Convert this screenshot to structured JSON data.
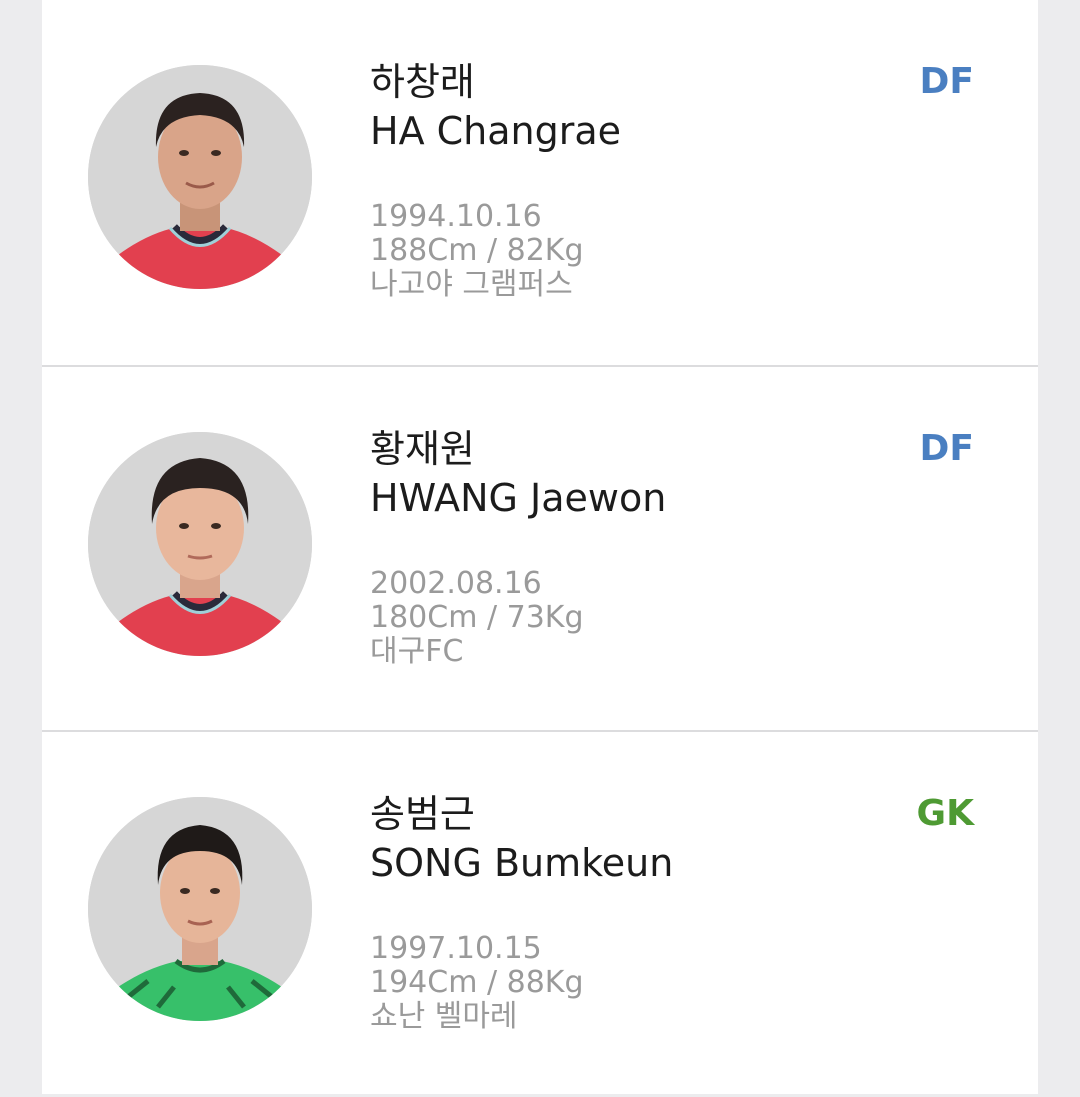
{
  "colors": {
    "df": "#4a7fc1",
    "gk": "#4e9a33",
    "jersey_red": "#e0334a",
    "jersey_green": "#37c06a"
  },
  "players": [
    {
      "name_ko": "하창래",
      "name_en": "HA Changrae",
      "birth": "1994.10.16",
      "body": "188Cm / 82Kg",
      "club": "나고야 그램퍼스",
      "position": "DF",
      "photo_icon": "player-photo"
    },
    {
      "name_ko": "황재원",
      "name_en": "HWANG Jaewon",
      "birth": "2002.08.16",
      "body": "180Cm / 73Kg",
      "club": "대구FC",
      "position": "DF",
      "photo_icon": "player-photo"
    },
    {
      "name_ko": "송범근",
      "name_en": "SONG Bumkeun",
      "birth": "1997.10.15",
      "body": "194Cm / 88Kg",
      "club": "쇼난 벨마레",
      "position": "GK",
      "photo_icon": "player-photo"
    }
  ]
}
